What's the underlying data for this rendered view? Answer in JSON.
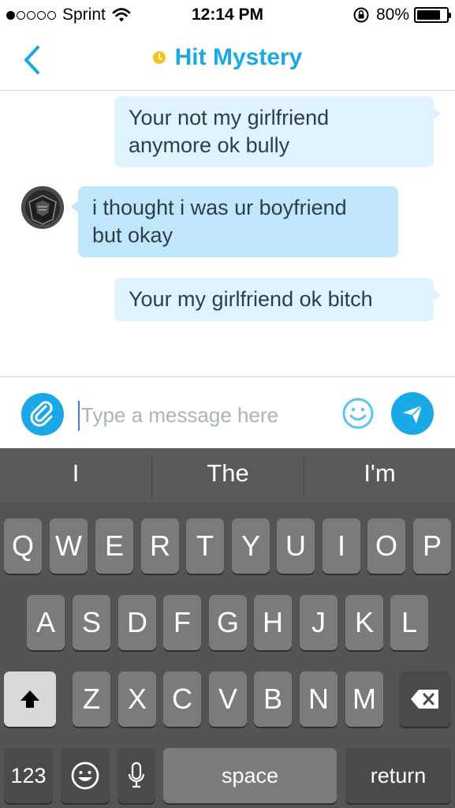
{
  "status_bar": {
    "carrier": "Sprint",
    "time": "12:14 PM",
    "battery": "80%",
    "battery_level": 0.8,
    "signal_dots_filled": 1,
    "signal_dots_total": 5
  },
  "header": {
    "title": "Hit Mystery",
    "status_color": "#f7c21b",
    "accent_color": "#1ba8e6"
  },
  "messages": [
    {
      "direction": "outgoing",
      "lines": [
        "Your not my girlfriend",
        "anymore ok bully"
      ]
    },
    {
      "direction": "incoming",
      "lines": [
        "i thought i was ur boyfriend",
        "but okay"
      ]
    },
    {
      "direction": "outgoing",
      "lines": [
        "Your my girlfriend ok bitch"
      ]
    }
  ],
  "composer": {
    "placeholder": "Type a message here",
    "value": ""
  },
  "keyboard": {
    "suggestions": [
      "I",
      "The",
      "I'm"
    ],
    "row1": [
      "Q",
      "W",
      "E",
      "R",
      "T",
      "Y",
      "U",
      "I",
      "O",
      "P"
    ],
    "row2": [
      "A",
      "S",
      "D",
      "F",
      "G",
      "H",
      "J",
      "K",
      "L"
    ],
    "row3": [
      "Z",
      "X",
      "C",
      "V",
      "B",
      "N",
      "M"
    ],
    "numbers_label": "123",
    "space_label": "space",
    "return_label": "return"
  }
}
